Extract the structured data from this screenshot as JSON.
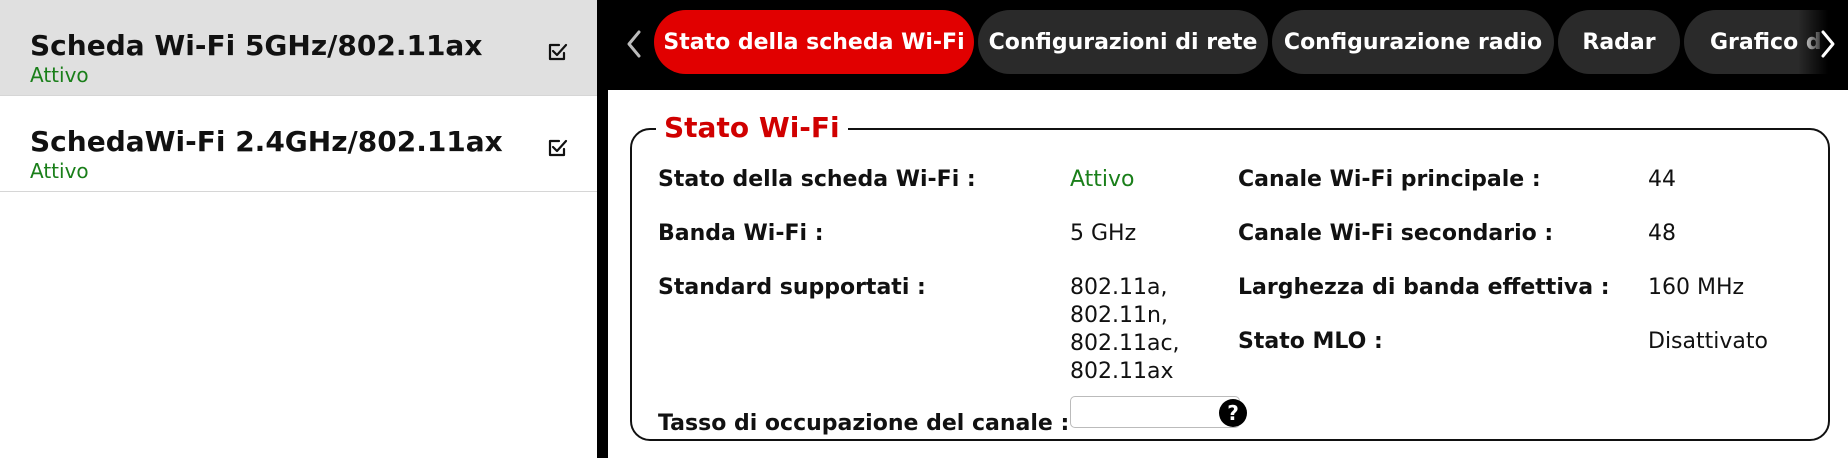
{
  "sidebar": {
    "cards": [
      {
        "title": "Scheda Wi-Fi 5GHz/802.11ax",
        "status": "Attivo"
      },
      {
        "title": "SchedaWi-Fi 2.4GHz/802.11ax",
        "status": "Attivo"
      }
    ]
  },
  "tabs": [
    {
      "label": "Stato della scheda Wi-Fi"
    },
    {
      "label": "Configurazioni di rete"
    },
    {
      "label": "Configurazione radio"
    },
    {
      "label": "Radar"
    },
    {
      "label": "Grafico d"
    }
  ],
  "panel": {
    "legend": "Stato Wi-Fi",
    "labels": {
      "card_state": "Stato della scheda Wi-Fi :",
      "band": "Banda Wi-Fi :",
      "standards": "Standard supportati :",
      "occupancy": "Tasso di occupazione del canale :",
      "main_channel": "Canale Wi-Fi principale :",
      "secondary_channel": "Canale Wi-Fi secondario :",
      "bandwidth": "Larghezza di banda effettiva :",
      "mlo": "Stato MLO :"
    },
    "values": {
      "card_state": "Attivo",
      "band": "5 GHz",
      "standards": [
        "802.11a,",
        "802.11n,",
        "802.11ac,",
        "802.11ax"
      ],
      "main_channel": "44",
      "secondary_channel": "48",
      "bandwidth": "160 MHz",
      "mlo": "Disattivato"
    },
    "help_glyph": "?"
  },
  "colors": {
    "accent_red": "#e10000",
    "status_green": "#1a7f1a",
    "tab_dark": "#2a2a2a"
  },
  "icons": {
    "card_check": "checkbox-checked-icon",
    "nav_left": "chevron-left-icon",
    "nav_right": "chevron-right-icon",
    "help": "help-icon"
  }
}
